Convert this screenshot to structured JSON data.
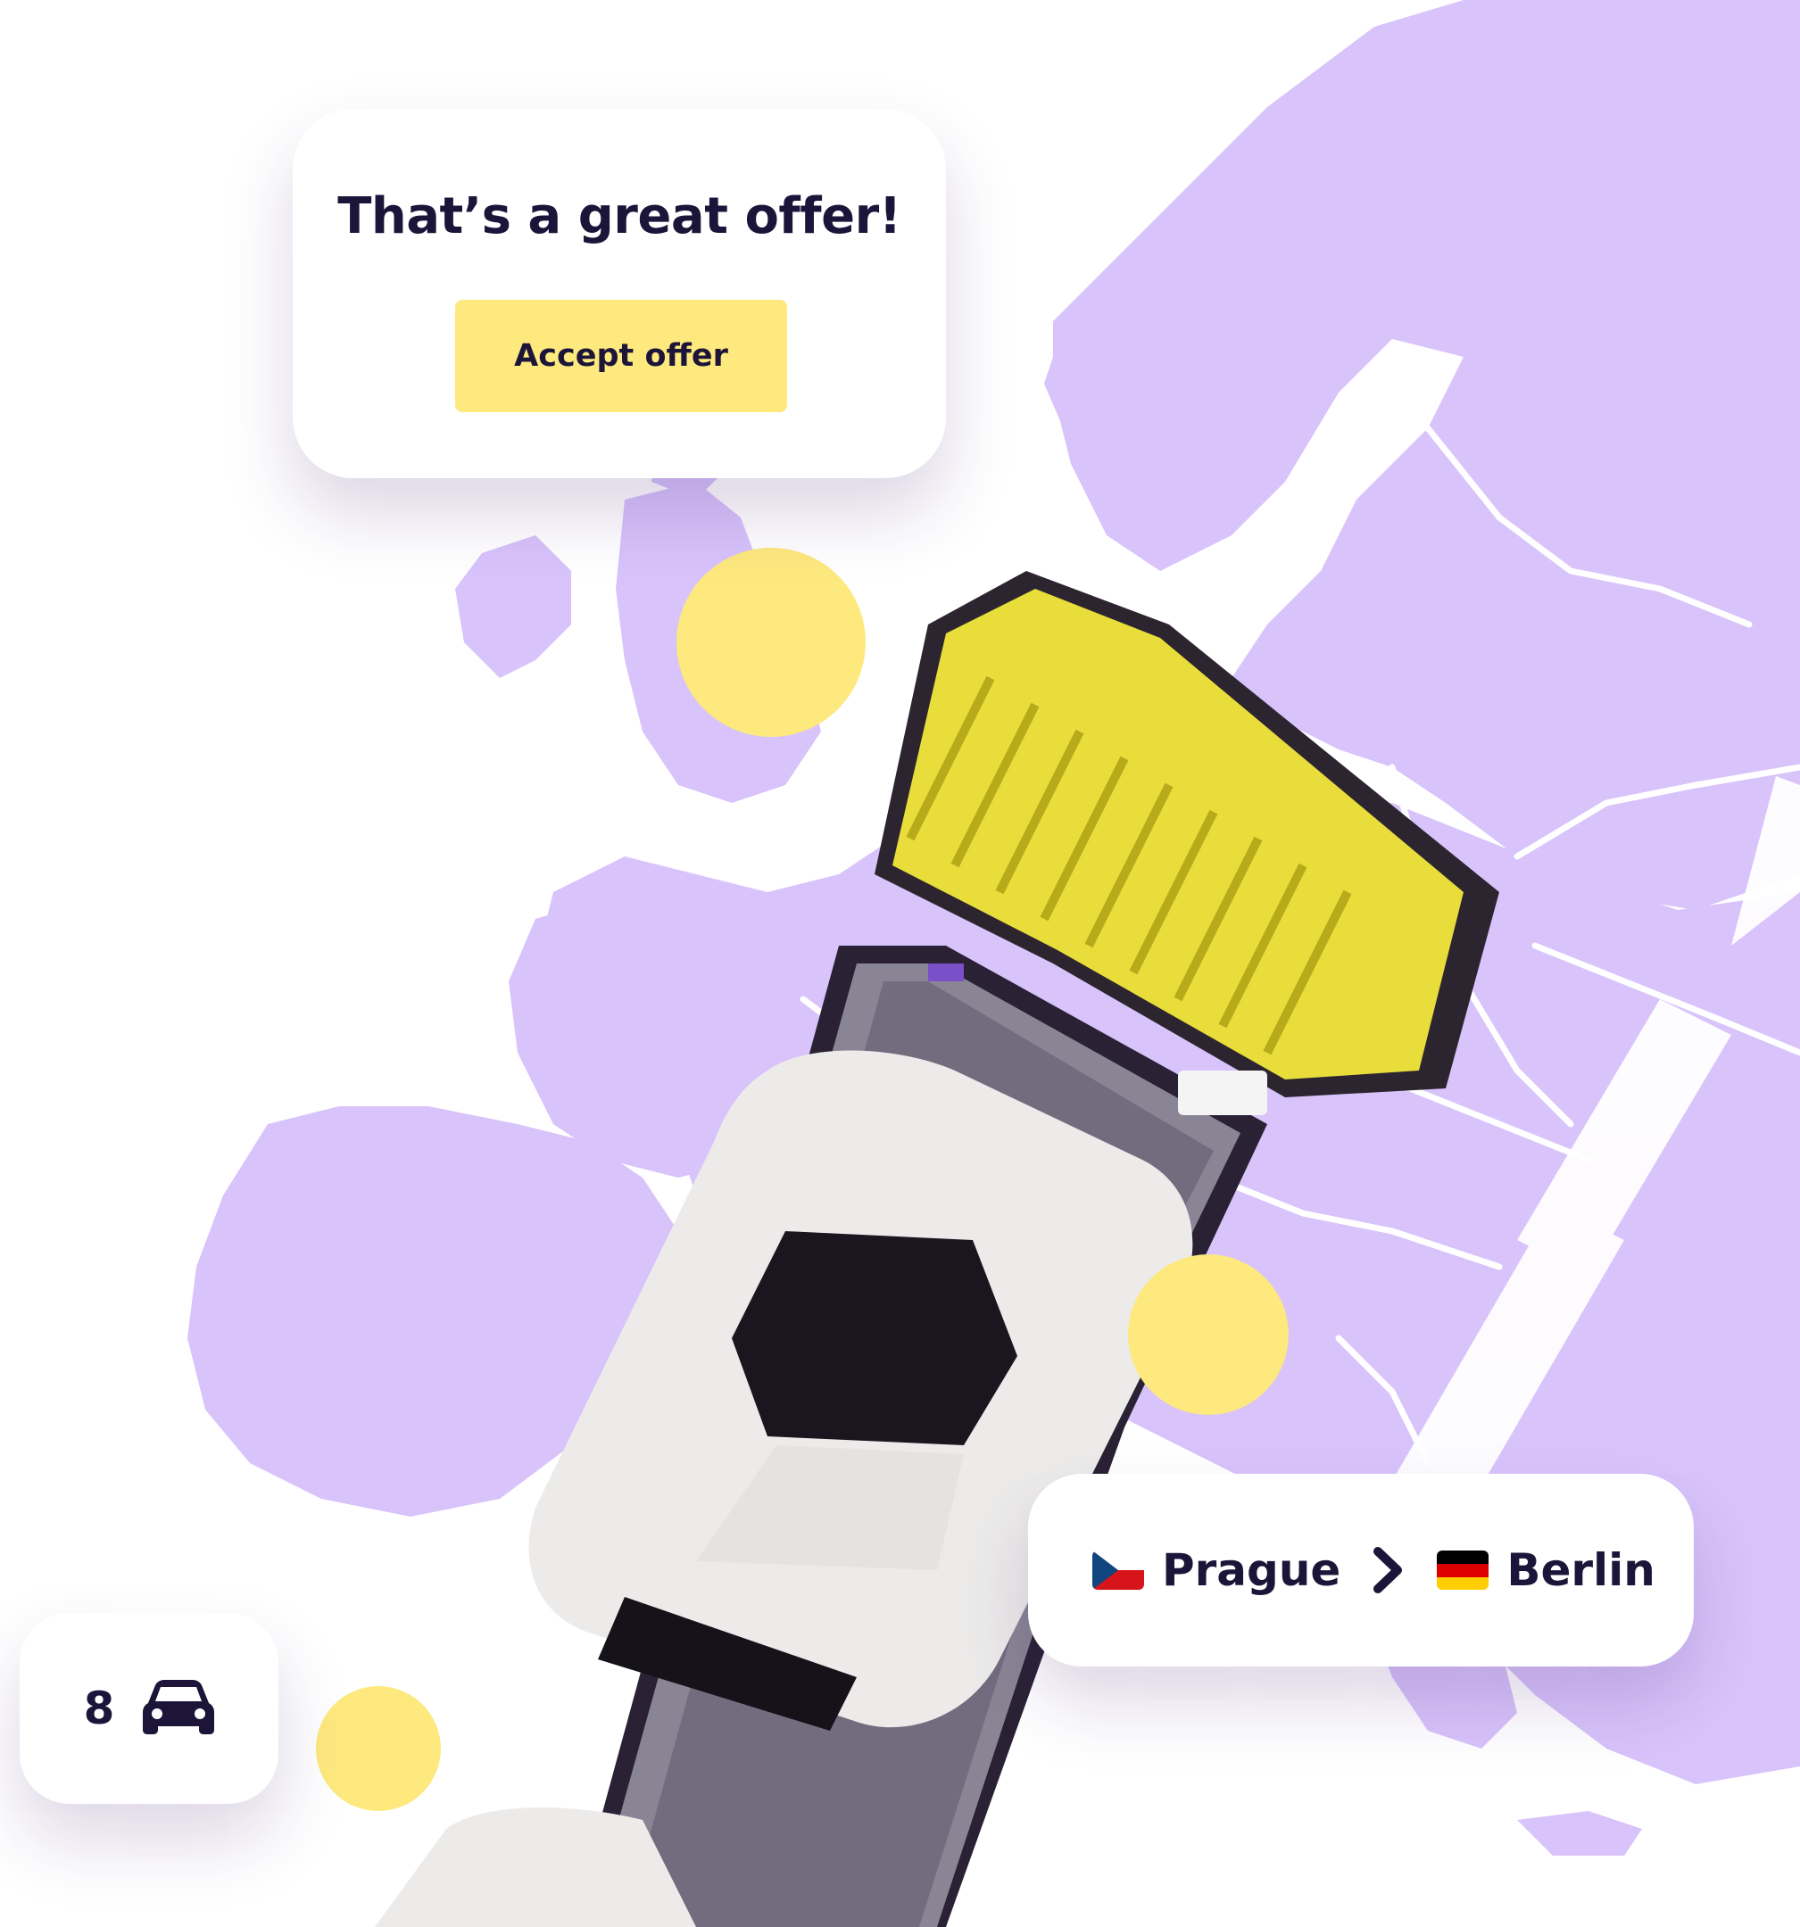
{
  "offer_card": {
    "title": "That’s a great offer!",
    "accept_label": "Accept offer"
  },
  "route_card": {
    "origin": {
      "city": "Prague",
      "flag": "czech-flag-icon"
    },
    "separator": "chevron-right-icon",
    "destination": {
      "city": "Berlin",
      "flag": "german-flag-icon"
    }
  },
  "vehicle_count": {
    "value": "8",
    "icon": "car-icon"
  },
  "colors": {
    "map_land": "#d8c3fb",
    "accent_yellow": "#fde97e",
    "text_dark": "#1c1539",
    "truck_cab": "#e8dd3a",
    "car_body": "#ecebea"
  }
}
